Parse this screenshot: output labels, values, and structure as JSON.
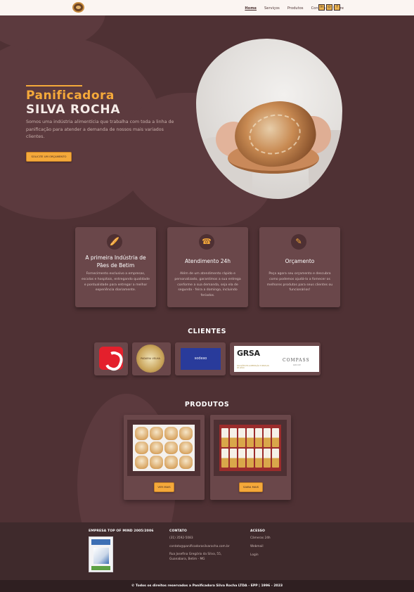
{
  "nav": {
    "links": [
      "Home",
      "Serviços",
      "Produtos",
      "Contato",
      "Sobre"
    ],
    "social": [
      {
        "icon": "linkedin-icon",
        "glyph": "in"
      },
      {
        "icon": "instagram-icon",
        "glyph": "◎"
      },
      {
        "icon": "facebook-icon",
        "glyph": "f"
      }
    ]
  },
  "hero": {
    "title_line1": "Panificadora",
    "title_line2": "SILVA ROCHA",
    "description": "Somos uma indústria alimentícia que trabalha com toda a linha de panificação para atender a demanda de nossos mais variados clientes.",
    "button_label": "SOLICITE UM ORÇAMENTO"
  },
  "features": [
    {
      "icon": "bread-icon",
      "glyph": "🥖",
      "title": "A primeira Indústria de Pães de Betim",
      "text": "Fornecimento exclusivo a empresas, escolas e hospitais, entregando qualidade e pontualidade para entregar a melhor experiência diariamente."
    },
    {
      "icon": "headset-icon",
      "glyph": "☎",
      "title": "Atendimento 24h",
      "text": "Além de um atendimento rápido e personalizado, garantimos a sua entrega conforme a sua demanda, seja ela de segunda - feira a domingo, incluindo feriados."
    },
    {
      "icon": "budget-icon",
      "glyph": "✎",
      "title": "Orçamento",
      "text": "Peça agora seu orçamento e descubra como podemos ajudá-lo a fornecer os melhores produtos para seus clientes ou funcionários!"
    }
  ],
  "clients": {
    "title": "CLIENTES",
    "logos": {
      "padaria": "PADARIA VELHA",
      "sodexo": "sodexo",
      "grsa": "GRSA",
      "grsa_sub": "SOLUÇÕES EM ALIMENTAÇÃO E SERVIÇOS DE APOIO",
      "compass": "COMPASS",
      "compass_sub": "GROUP"
    }
  },
  "products": {
    "title": "PRODUTOS",
    "items": [
      {
        "button_label": "VER MAIS"
      },
      {
        "button_label": "SAIBA MAIS"
      }
    ]
  },
  "footer": {
    "col1_title": "EMPRESA TOP OF MIND 2005/2006",
    "col2_title": "CONTATO",
    "phone": "(31) 3592-5083",
    "email": "contato@panificadorasilvarocha.com.br",
    "address": "Rua Josefina Gregório da Silva, 55, Guanabara, Betim - MG",
    "col3_title": "ACESSO",
    "links": [
      "Câmeras 24h",
      "Webmail",
      "Login"
    ]
  },
  "copyright": "© Todos os direitos reservados a Panificadora Silva Rocha LTDA - EPP | 1996 - 2023",
  "colors": {
    "background": "#4f3134",
    "card": "#6a474a",
    "accent": "#f5a93a",
    "footer": "#3f2a2c"
  }
}
